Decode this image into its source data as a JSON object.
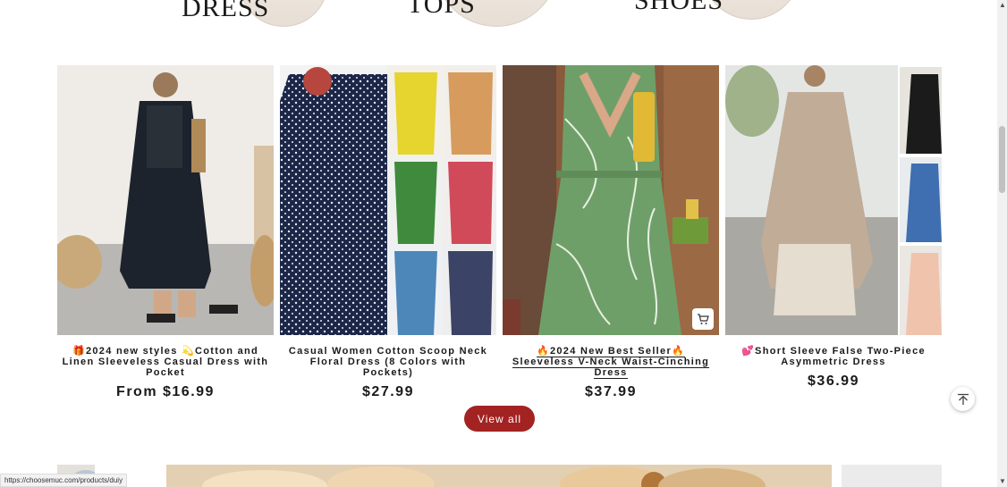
{
  "categories": [
    {
      "label": "DRESS"
    },
    {
      "label": "TOPS"
    },
    {
      "label": "SHOES"
    }
  ],
  "products": [
    {
      "title": "🎁2024 new styles 💫Cotton and Linen Sleeveless Casual Dress with Pocket",
      "price": "From $16.99"
    },
    {
      "title": "Casual Women Cotton Scoop Neck Floral Dress (8 Colors with Pockets)",
      "price": "$27.99"
    },
    {
      "title": "🔥2024 New Best Seller🔥Sleeveless V-Neck Waist-Cinching Dress",
      "price": "$37.99"
    },
    {
      "title": "💕Short Sleeve False Two-Piece Asymmetric Dress",
      "price": "$36.99"
    }
  ],
  "view_all": "View all",
  "status_url": "https://choosemuc.com/products/duiy",
  "icons": {
    "cart": "cart-icon",
    "back_to_top": "arrow-up-icon"
  },
  "colors": {
    "button": "#a32322"
  }
}
